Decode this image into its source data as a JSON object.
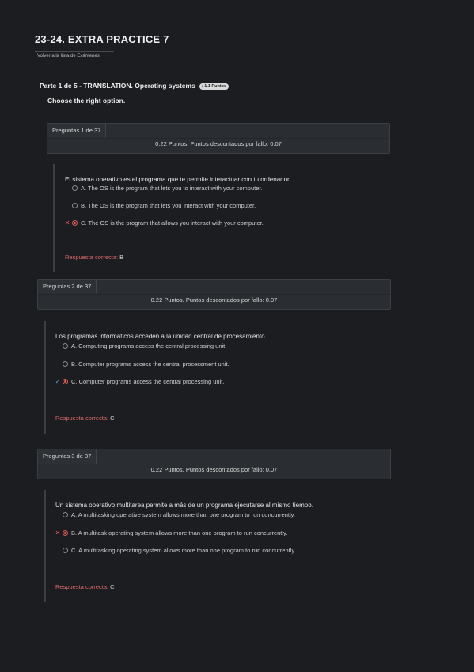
{
  "exam": {
    "title": "23-24. EXTRA PRACTICE 7",
    "back_link": "Volver a la lista de Exámenes"
  },
  "part": {
    "header": "Parte 1 de 5 - TRANSLATION. Operating systems",
    "points_badge": "/ 1.1 Puntos",
    "instruction": "Choose the right option."
  },
  "questions": [
    {
      "label": "Preguntas 1 de 37",
      "points": "0.22 Puntos. Puntos descontados por fallo: 0.07",
      "statement": "El sistema operativo es el programa que te permite interactuar con tu ordenador.",
      "options": [
        {
          "text": "A. The OS is the program that lets you to interact with your computer."
        },
        {
          "text": "B. The OS is the program that lets you interact with your computer."
        },
        {
          "text": "C. The OS is the program that allows you interact with your computer."
        }
      ],
      "correct_label": "Respuesta correcta:",
      "correct_answer": "B"
    },
    {
      "label": "Preguntas 2 de 37",
      "points": "0.22 Puntos. Puntos descontados por fallo: 0.07",
      "statement": "Los programas informáticos acceden a la unidad central de procesamiento.",
      "options": [
        {
          "text": "A. Computing programs access the central processing unit."
        },
        {
          "text": "B. Computer programs access the central processment unit."
        },
        {
          "text": "C. Computer programs access the central processing unit."
        }
      ],
      "correct_label": "Respuesta correcta:",
      "correct_answer": "C"
    },
    {
      "label": "Preguntas 3 de 37",
      "points": "0.22 Puntos. Puntos descontados por fallo: 0.07",
      "statement": "Un sistema operativo multitarea permite a más de un programa ejecutarse al mismo tiempo.",
      "options": [
        {
          "text": "A. A multitasking operative system allows more than one program to run concurrently."
        },
        {
          "text": "B. A multitask operating system allows more than one program to run concurrently."
        },
        {
          "text": "C. A multitasking operating system allows more than one program to run concurrently."
        }
      ],
      "correct_label": "Respuesta correcta:",
      "correct_answer": "C"
    }
  ],
  "marks": {
    "wrong": "✕",
    "right": "✓"
  }
}
